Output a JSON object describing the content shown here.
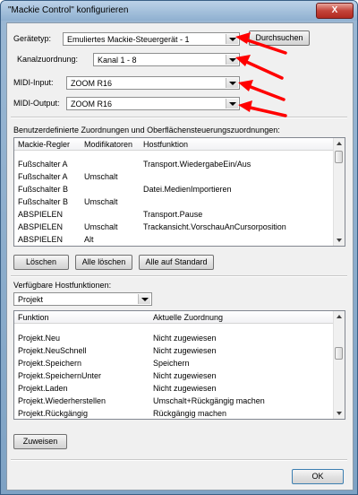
{
  "window": {
    "title": "\"Mackie Control\" konfigurieren",
    "close": "X"
  },
  "form": {
    "device_label": "Gerätetyp:",
    "device_value": "Emuliertes Mackie-Steuergerät - 1",
    "browse_label": "Durchsuchen",
    "channel_label": "Kanalzuordnung:",
    "channel_value": "Kanal 1 - 8",
    "midi_in_label": "MIDI-Input:",
    "midi_in_value": "ZOOM R16",
    "midi_out_label": "MIDI-Output:",
    "midi_out_value": "ZOOM R16"
  },
  "mapping": {
    "section_label": "Benutzerdefinierte Zuordnungen und Oberflächensteuerungszuordnungen:",
    "columns": [
      "Mackie-Regler",
      "Modifikatoren",
      "Hostfunktion"
    ],
    "rows": [
      [
        "Fußschalter A",
        "",
        "Transport.WiedergabeEin/Aus"
      ],
      [
        "Fußschalter A",
        "Umschalt",
        ""
      ],
      [
        "Fußschalter B",
        "",
        "Datei.MedienImportieren"
      ],
      [
        "Fußschalter B",
        "Umschalt",
        ""
      ],
      [
        "ABSPIELEN",
        "",
        "Transport.Pause"
      ],
      [
        "ABSPIELEN",
        "Umschalt",
        "Trackansicht.VorschauAnCursorposition"
      ],
      [
        "ABSPIELEN",
        "Alt",
        ""
      ]
    ],
    "delete_label": "Löschen",
    "delete_all_label": "Alle löschen",
    "reset_label": "Alle auf Standard"
  },
  "host": {
    "section_label": "Verfügbare Hostfunktionen:",
    "category_value": "Projekt",
    "columns": [
      "Funktion",
      "Aktuelle Zuordnung"
    ],
    "rows": [
      [
        "Projekt.Neu",
        "Nicht zugewiesen"
      ],
      [
        "Projekt.NeuSchnell",
        "Nicht zugewiesen"
      ],
      [
        "Projekt.Speichern",
        "Speichern"
      ],
      [
        "Projekt.SpeichernUnter",
        "Nicht zugewiesen"
      ],
      [
        "Projekt.Laden",
        "Nicht zugewiesen"
      ],
      [
        "Projekt.Wiederherstellen",
        "Umschalt+Rückgängig machen"
      ],
      [
        "Projekt.Rückgängig",
        "Rückgängig machen"
      ]
    ],
    "assign_label": "Zuweisen"
  },
  "footer": {
    "ok_label": "OK"
  },
  "colors": {
    "annotation_arrow": "#ff0000",
    "titlebar": "#9bb8d4"
  }
}
